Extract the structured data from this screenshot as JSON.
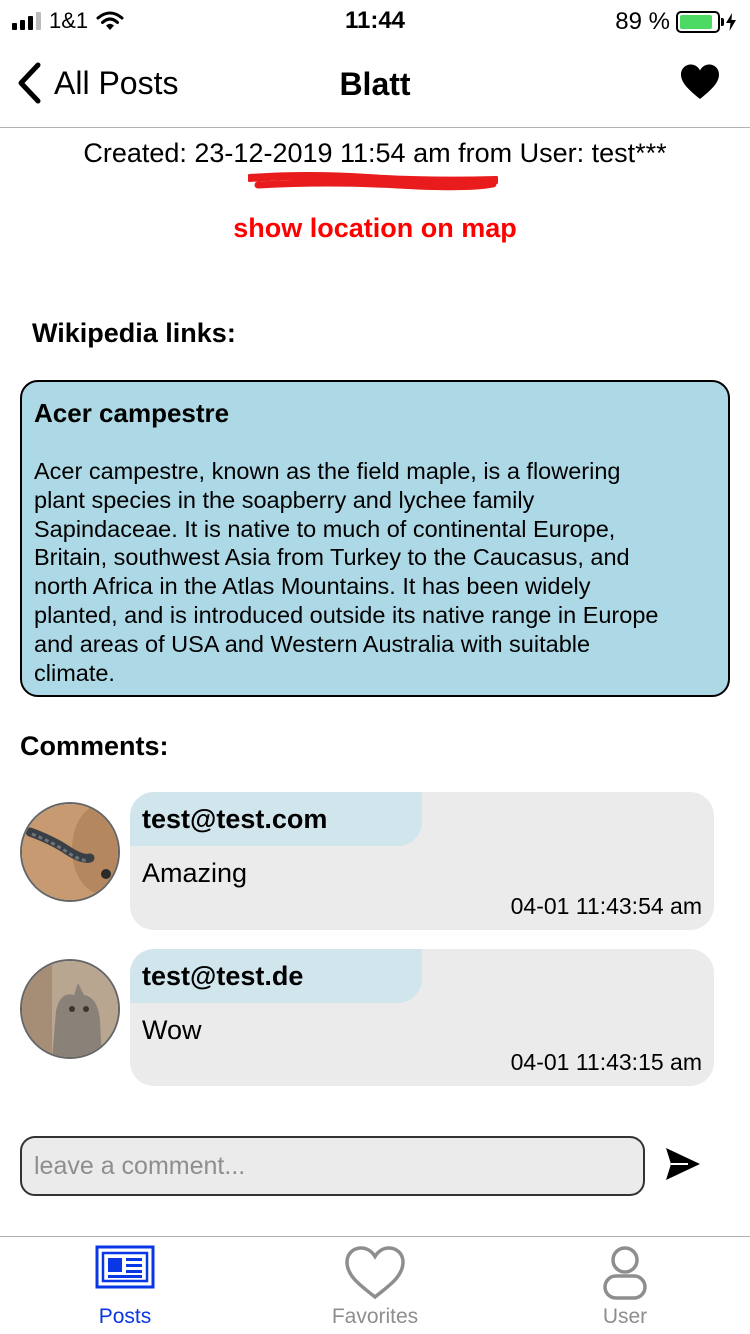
{
  "status_bar": {
    "carrier": "1&1",
    "time": "11:44",
    "battery_percent": "89 %",
    "battery_level": 0.89,
    "battery_color": "#4cd964"
  },
  "nav": {
    "back_label": "All Posts",
    "title": "Blatt",
    "favorite_icon": "heart-filled-icon"
  },
  "post": {
    "created": "Created: 23-12-2019 11:54 am from User: test***",
    "map_link": "show location on map",
    "map_link_color": "#ff0000"
  },
  "wiki": {
    "section_title": "Wikipedia links:",
    "card_color": "#add8e6",
    "title": "Acer campestre",
    "lines": [
      "Acer campestre, known as the field maple, is a flowering",
      "plant species in the soapberry and lychee family",
      "Sapindaceae. It is native to much of continental Europe,",
      "Britain, southwest Asia from Turkey to the Caucasus, and",
      "north Africa in the Atlas Mountains. It has been widely",
      "planted, and is introduced outside its native range in Europe",
      "and areas of USA and Western Australia with suitable",
      "climate."
    ]
  },
  "comments": {
    "section_title": "Comments:",
    "items": [
      {
        "user": "test@test.com",
        "text": "Amazing",
        "time": "04-01 11:43:54 am"
      },
      {
        "user": "test@test.de",
        "text": "Wow",
        "time": "04-01 11:43:15 am"
      }
    ]
  },
  "comment_input": {
    "placeholder": "leave a comment...",
    "value": ""
  },
  "tabs": [
    {
      "label": "Posts",
      "icon": "newspaper-icon",
      "active": true
    },
    {
      "label": "Favorites",
      "icon": "heart-outline-icon",
      "active": false
    },
    {
      "label": "User",
      "icon": "user-icon",
      "active": false
    }
  ],
  "colors": {
    "active_tab": "#0a37e6",
    "inactive_tab": "#8e8e8e",
    "bubble": "#ebebeb",
    "bubble_head": "#d1e6ec"
  }
}
